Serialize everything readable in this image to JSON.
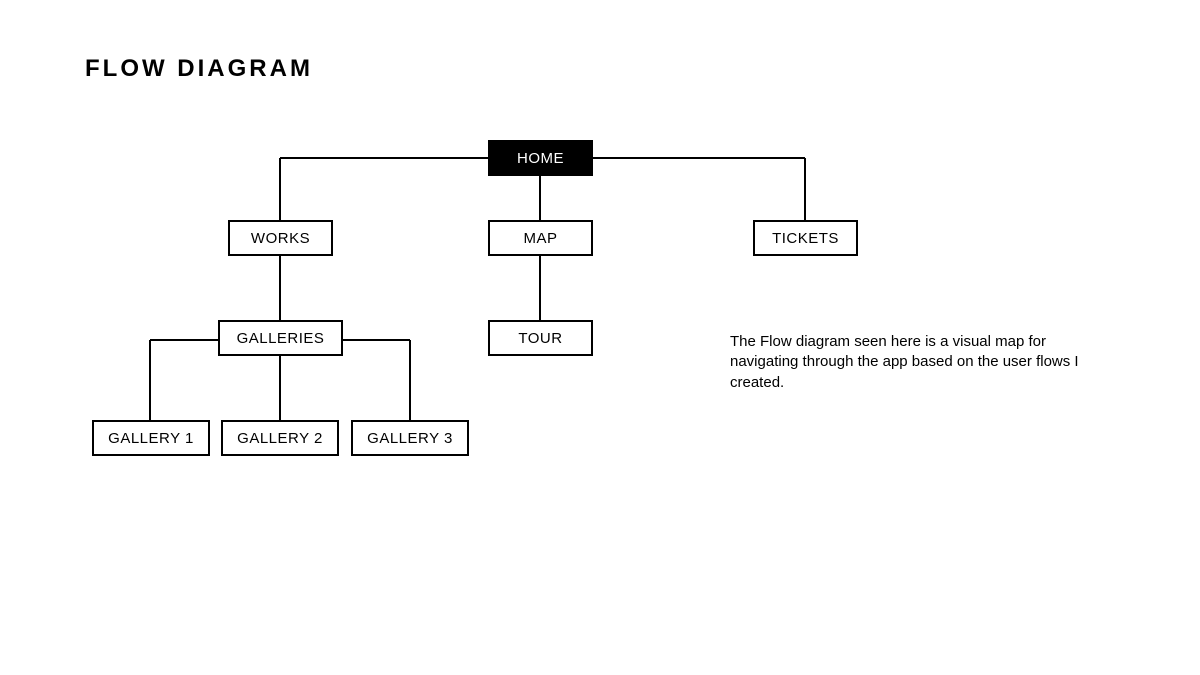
{
  "title": "FLOW DIAGRAM",
  "description": "The Flow diagram seen here is a visual map for navigating through the app based on the user flows I created.",
  "nodes": {
    "home": "HOME",
    "works": "WORKS",
    "map": "MAP",
    "tickets": "TICKETS",
    "galleries": "GALLERIES",
    "tour": "TOUR",
    "gallery1": "GALLERY 1",
    "gallery2": "GALLERY 2",
    "gallery3": "GALLERY 3"
  }
}
